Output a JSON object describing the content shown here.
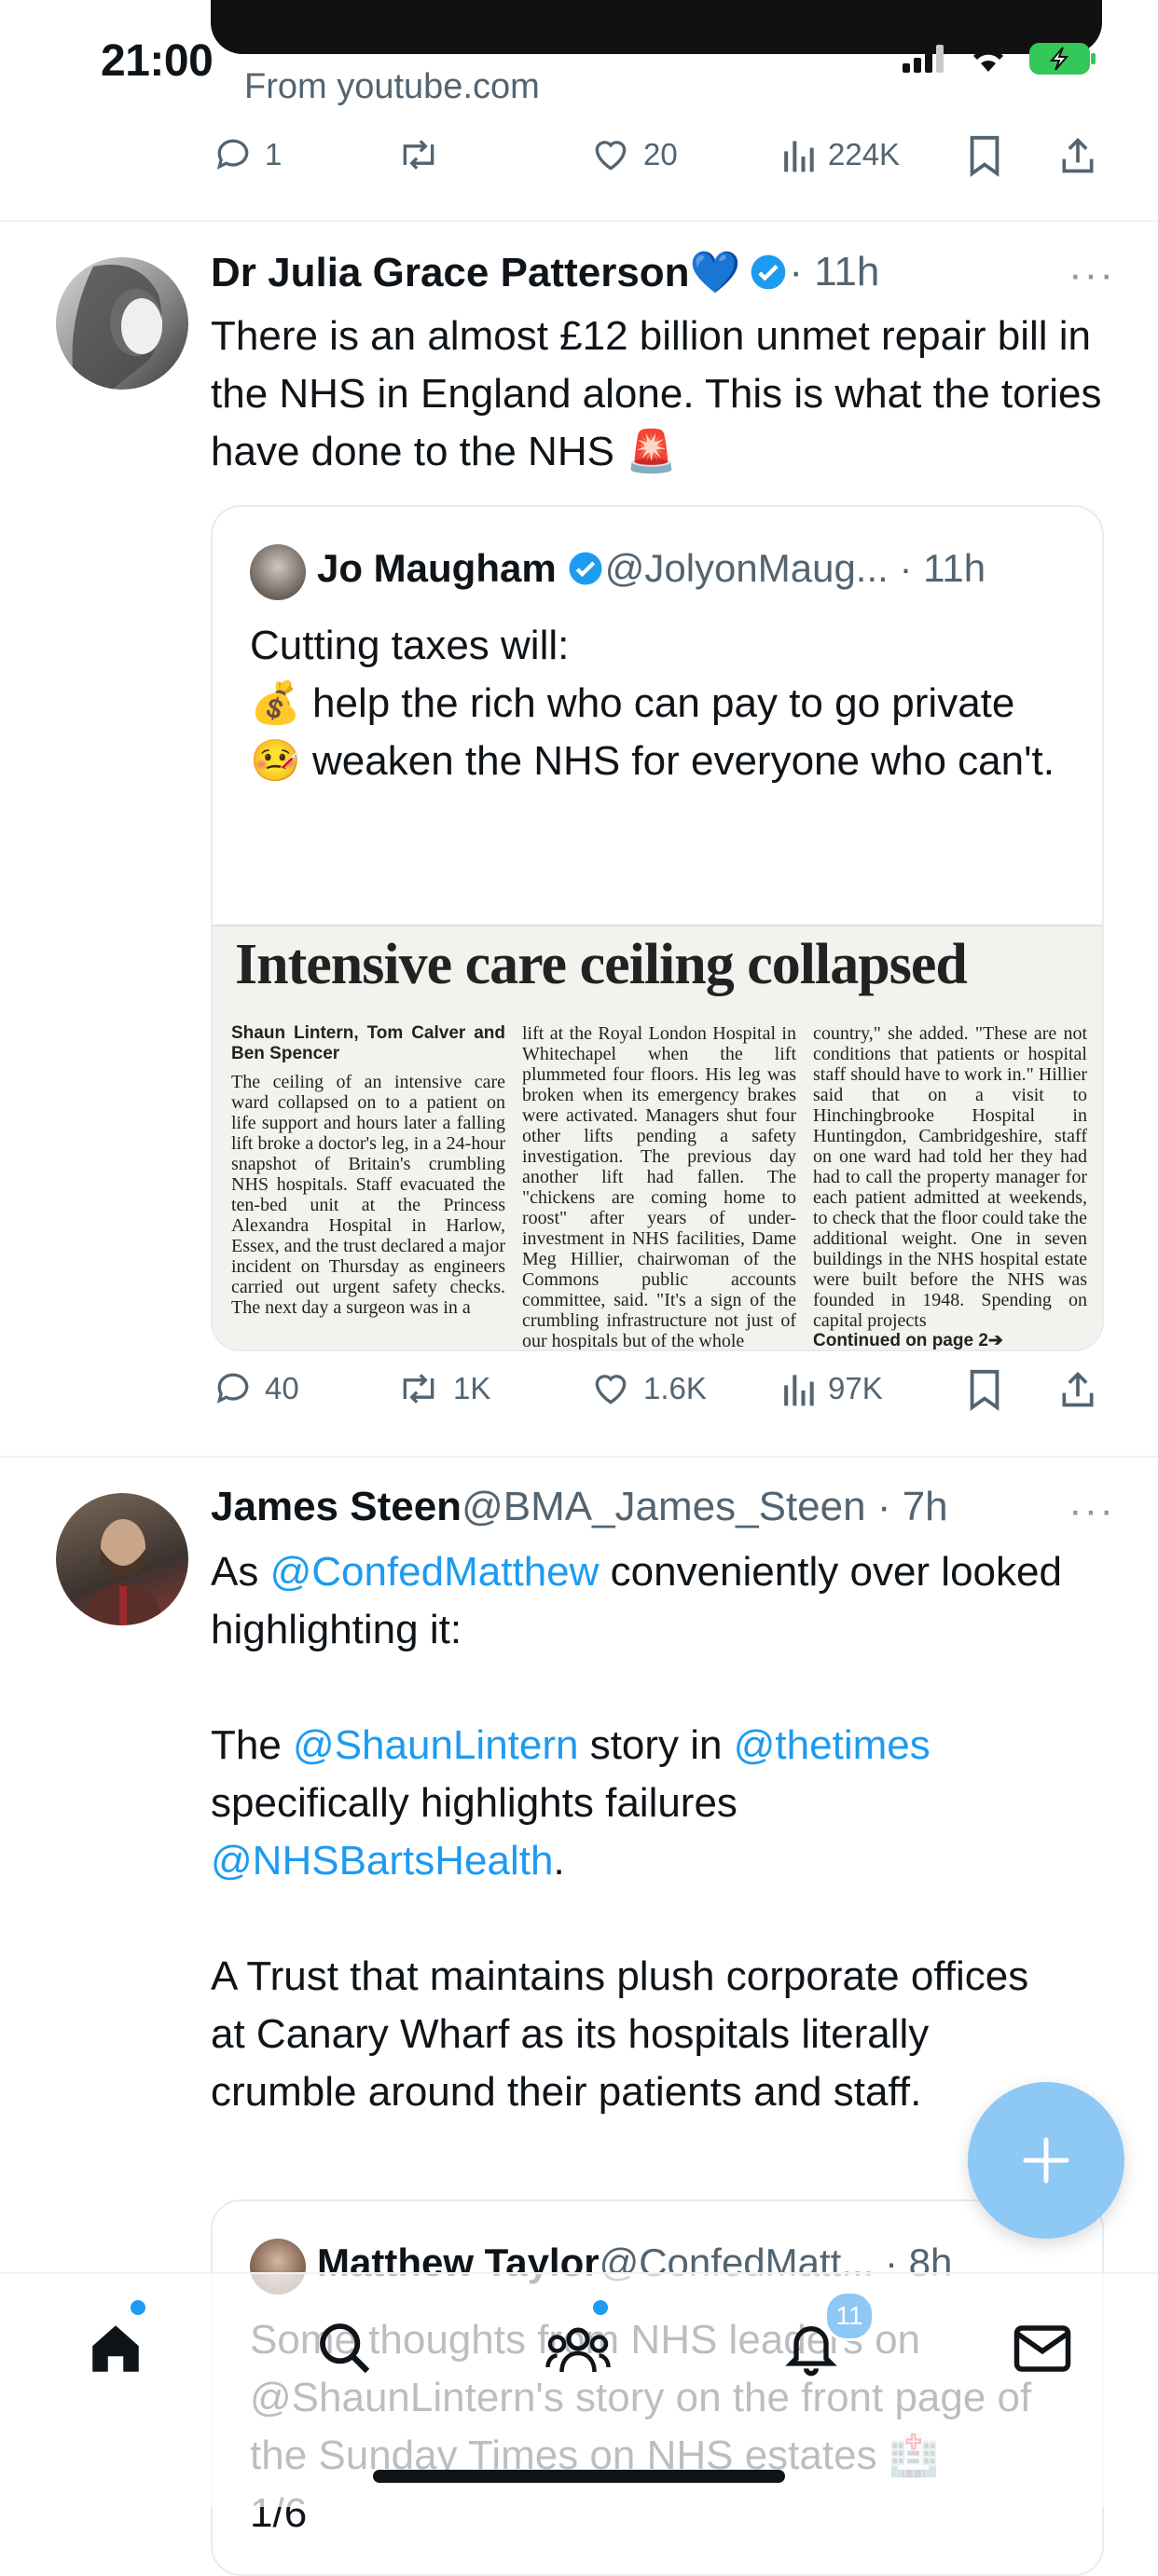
{
  "status": {
    "time": "21:00"
  },
  "top_tweet": {
    "source": "From youtube.com",
    "actions": {
      "replies": "1",
      "retweets": "",
      "likes": "20",
      "views": "224K"
    }
  },
  "tweet1": {
    "name": "Dr Julia Grace Patterson💙",
    "meta": " · 11h",
    "text": "There is an almost £12 billion unmet repair bill in the NHS in England alone. This is what the tories have done to the NHS 🚨",
    "quote": {
      "name": "Jo Maugham",
      "handle_time": " @JolyonMaug... · 11h",
      "text": "Cutting taxes will:\n💰 help the rich who can pay to go private\n🤒 weaken the NHS for everyone who can't.",
      "newspaper": {
        "headline": "Intensive care ceiling collapsed",
        "byline": "Shaun Lintern, Tom Calver and Ben Spencer",
        "col1": "The ceiling of an intensive care ward collapsed on to a patient on life support and hours later a falling lift broke a doctor's leg, in a 24-hour snapshot of Britain's crumbling NHS hospitals. Staff evacuated the ten-bed unit at the Princess Alexandra Hospital in Harlow, Essex, and the trust declared a major incident on Thursday as engineers carried out urgent safety checks. The next day a surgeon was in a",
        "col2": "lift at the Royal London Hospital in Whitechapel when the lift plummeted four floors. His leg was broken when its emergency brakes were activated. Managers shut four other lifts pending a safety investigation. The previous day another lift had fallen. The \"chickens are coming home to roost\" after years of under-investment in NHS facilities, Dame Meg Hillier, chairwoman of the Commons public accounts committee, said. \"It's a sign of the crumbling infrastructure not just of our hospitals but of the whole",
        "col3": "country,\" she added. \"These are not conditions that patients or hospital staff should have to work in.\" Hillier said that on a visit to Hinchingbrooke Hospital in Huntingdon, Cambridgeshire, staff on one ward had told her they had had to call the property manager for each patient admitted at weekends, to check that the floor could take the additional weight. One in seven buildings in the NHS hospital estate were built before the NHS was founded in 1948. Spending on capital projects",
        "continued": "Continued on page 2➔"
      }
    },
    "actions": {
      "replies": "40",
      "retweets": "1K",
      "likes": "1.6K",
      "views": "97K"
    }
  },
  "tweet2": {
    "name": "James Steen",
    "meta": " @BMA_James_Steen · 7h",
    "text": {
      "p1a": "As ",
      "p1_link": "@ConfedMatthew",
      "p1b": " conveniently over looked highlighting it:",
      "p2a": "The ",
      "p2_link1": "@ShaunLintern",
      "p2b": " story in ",
      "p2_link2": "@thetimes",
      "p2c": " specifically highlights failures ",
      "p2_link3": "@NHSBartsHealth",
      "p2d": ".",
      "p3": "A Trust that maintains plush corporate offices at Canary Wharf as its hospitals literally crumble around their patients and staff."
    },
    "quote": {
      "name": "Matthew Taylor",
      "handle_time": " @ConfedMatt... · 8h",
      "text": "Some thoughts from NHS leaders on @ShaunLintern's story on the front page of the Sunday Times on NHS estates 🏥\n1/6"
    }
  },
  "tabbar": {
    "notifications_badge": "11"
  },
  "colors": {
    "accent": "#1d9bf0",
    "text": "#0f1419",
    "muted": "#536471"
  },
  "icons": [
    "reply-icon",
    "retweet-icon",
    "like-icon",
    "views-icon",
    "bookmark-icon",
    "share-icon",
    "verified-icon",
    "more-icon",
    "compose-icon",
    "home-icon",
    "search-icon",
    "communities-icon",
    "notifications-icon",
    "messages-icon"
  ]
}
